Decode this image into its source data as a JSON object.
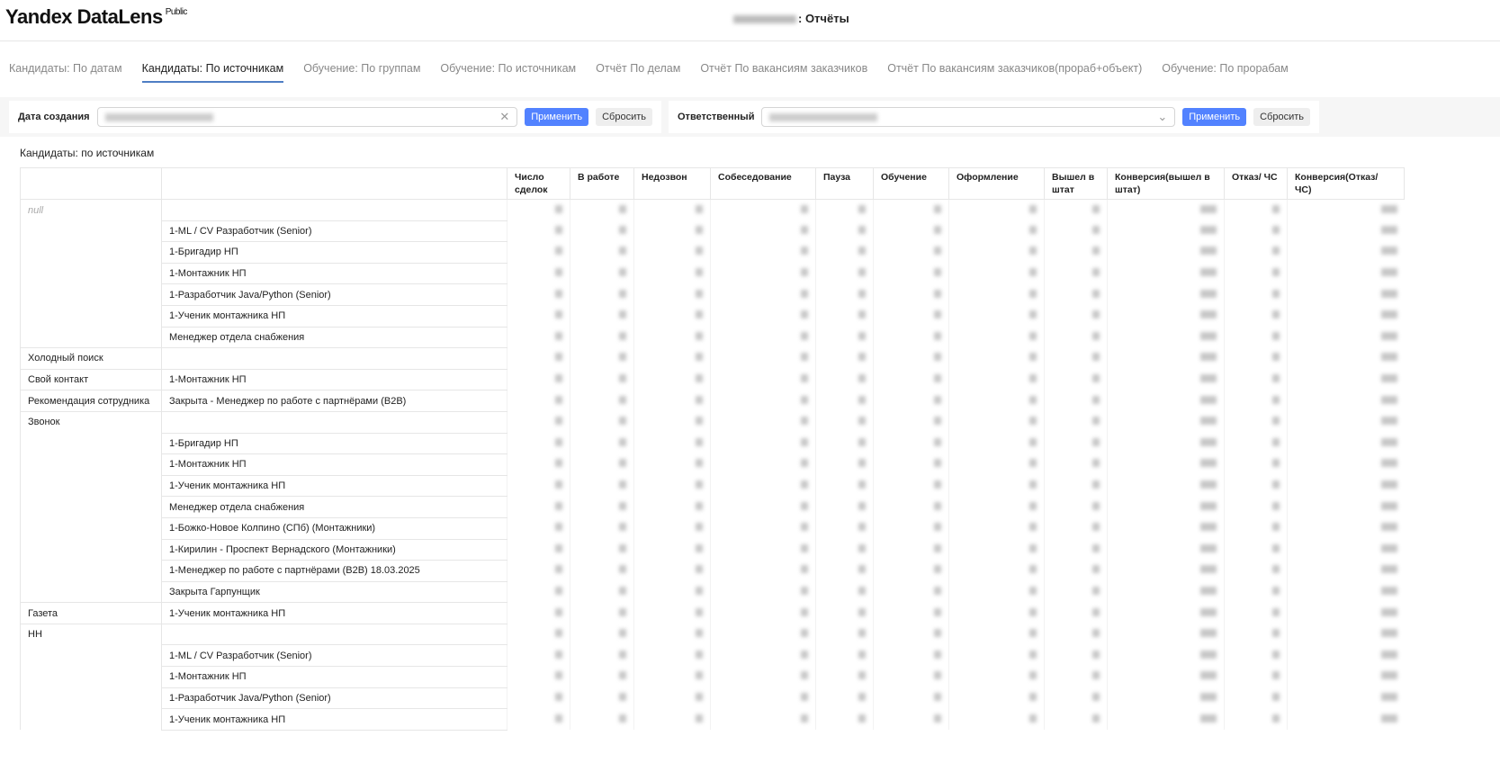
{
  "header": {
    "logo": "Yandex DataLens",
    "badge": "Public",
    "title_suffix": ": Отчёты"
  },
  "tabs": [
    {
      "label": "Кандидаты: По датам",
      "active": false
    },
    {
      "label": "Кандидаты: По источникам",
      "active": true
    },
    {
      "label": "Обучение: По группам",
      "active": false
    },
    {
      "label": "Обучение: По источникам",
      "active": false
    },
    {
      "label": "Отчёт По делам",
      "active": false
    },
    {
      "label": "Отчёт По вакансиям заказчиков",
      "active": false
    },
    {
      "label": "Отчёт По вакансиям заказчиков(прораб+объект)",
      "active": false
    },
    {
      "label": "Обучение: По прорабам",
      "active": false
    }
  ],
  "filters": {
    "date": {
      "label": "Дата создания",
      "apply": "Применить",
      "reset": "Сбросить"
    },
    "owner": {
      "label": "Ответственный",
      "apply": "Применить",
      "reset": "Сбросить"
    }
  },
  "table": {
    "title": "Кандидаты: по источникам",
    "columns": [
      "",
      "",
      "Число сделок",
      "В работе",
      "Недозвон",
      "Собеседование",
      "Пауза",
      "Обучение",
      "Оформление",
      "Вышел в штат",
      "Конверсия(вышел в штат)",
      "Отказ/ ЧС",
      "Конверсия(Отказ/ ЧС)"
    ],
    "rows": [
      [
        "null",
        ""
      ],
      [
        "",
        "1-ML / CV Разработчик (Senior)"
      ],
      [
        "",
        "1-Бригадир НП"
      ],
      [
        "",
        "1-Монтажник НП"
      ],
      [
        "",
        "1-Разработчик Java/Python (Senior)"
      ],
      [
        "",
        "1-Ученик монтажника НП"
      ],
      [
        "",
        "Менеджер отдела снабжения"
      ],
      [
        "Холодный поиск",
        ""
      ],
      [
        "Свой контакт",
        "1-Монтажник НП"
      ],
      [
        "Рекомендация сотрудника",
        "Закрыта - Менеджер по работе с партнёрами (B2B)"
      ],
      [
        "Звонок",
        ""
      ],
      [
        "",
        "1-Бригадир НП"
      ],
      [
        "",
        "1-Монтажник НП"
      ],
      [
        "",
        "1-Ученик монтажника НП"
      ],
      [
        "",
        "Менеджер отдела снабжения"
      ],
      [
        "",
        "1-Божко-Новое Колпино (СПб) (Монтажники)"
      ],
      [
        "",
        "1-Кирилин - Проспект Вернадского (Монтажники)"
      ],
      [
        "",
        "1-Менеджер по работе с партнёрами (B2B) 18.03.2025"
      ],
      [
        "",
        "Закрыта Гарпунщик"
      ],
      [
        "Газета",
        "1-Ученик монтажника НП"
      ],
      [
        "НН",
        ""
      ],
      [
        "",
        "1-ML / CV Разработчик (Senior)"
      ],
      [
        "",
        "1-Монтажник НП"
      ],
      [
        "",
        "1-Разработчик Java/Python (Senior)"
      ],
      [
        "",
        "1-Ученик монтажника НП"
      ]
    ]
  }
}
